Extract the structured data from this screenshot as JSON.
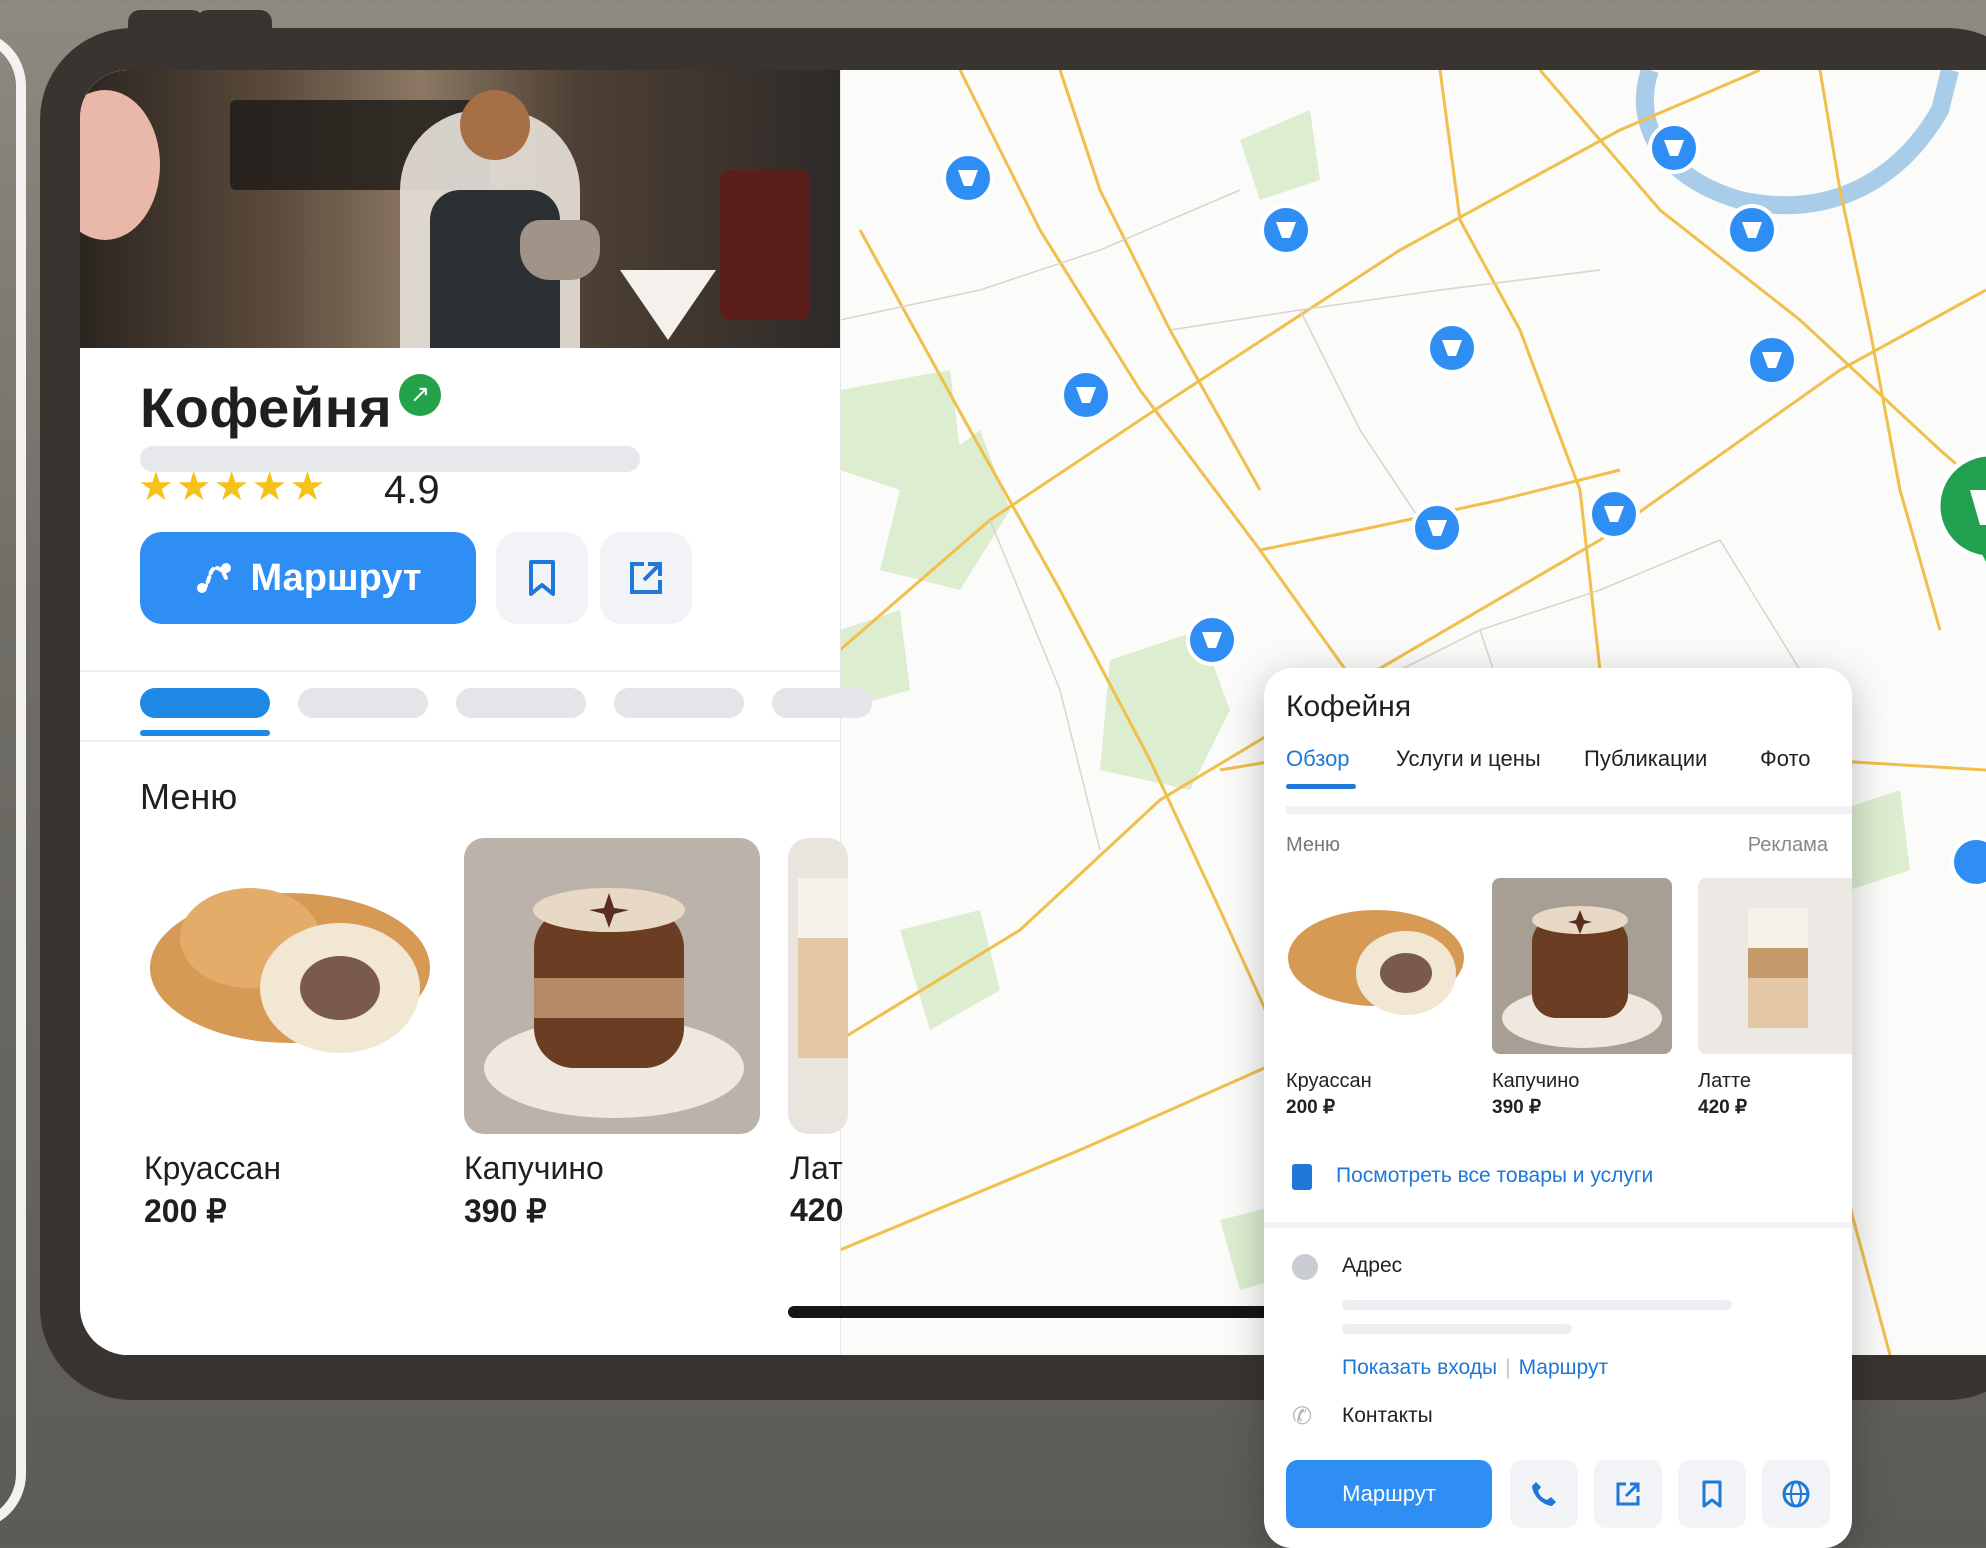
{
  "place": {
    "title": "Кофейня",
    "rating": "4.9",
    "stars": "★★★★★",
    "route_label": "Маршрут"
  },
  "panel": {
    "menu_heading": "Меню",
    "items": [
      {
        "name": "Круассан",
        "price": "200 ₽"
      },
      {
        "name": "Капучино",
        "price": "390 ₽"
      },
      {
        "name": "Лат",
        "price": "420"
      }
    ]
  },
  "card": {
    "title": "Кофейня",
    "tabs": [
      "Обзор",
      "Услуги и цены",
      "Публикации",
      "Фото"
    ],
    "menu_label": "Меню",
    "ad_label": "Реклама",
    "items": [
      {
        "name": "Круассан",
        "price": "200 ₽"
      },
      {
        "name": "Капучино",
        "price": "390 ₽"
      },
      {
        "name": "Латте",
        "price": "420 ₽"
      }
    ],
    "see_all": "Посмотреть все товары и услуги",
    "address_label": "Адрес",
    "show_entrances": "Показать входы",
    "route_link": "Маршрут",
    "contacts_label": "Контакты",
    "route_button": "Маршрут"
  },
  "colors": {
    "accent": "#2f8ef4",
    "link": "#1e78d7",
    "verified": "#22a34a",
    "star": "#f5c21a",
    "map_road": "#f0bf4c",
    "map_park": "#dcedd0",
    "map_pin": "#2f8ef4",
    "selected_pin": "#21a04f"
  },
  "icons": [
    "verified-icon",
    "route-icon",
    "bookmark-icon",
    "share-icon",
    "menu-list-icon",
    "location-icon",
    "phone-icon",
    "globe-icon",
    "coffee-pin-icon"
  ]
}
